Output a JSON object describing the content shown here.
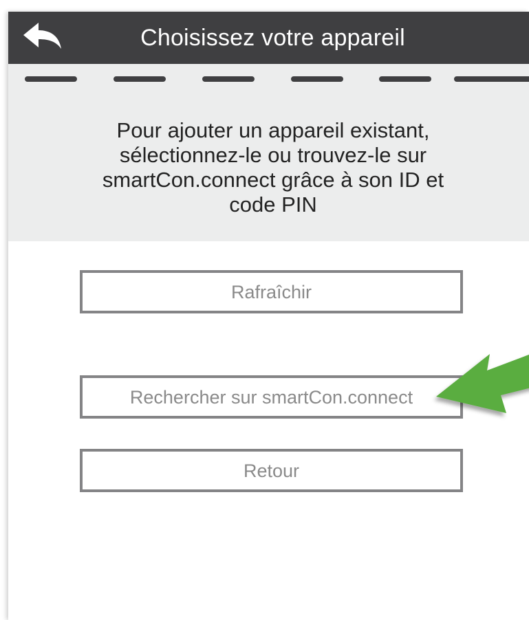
{
  "header": {
    "title": "Choisissez votre appareil",
    "back_icon": "back-arrow-icon"
  },
  "progress": {
    "segments": 6
  },
  "info": {
    "lines": [
      "Pour ajouter un appareil existant,",
      "sélectionnez-le ou trouvez-le sur",
      "smartCon.connect grâce à son ID et",
      "code PIN"
    ]
  },
  "buttons": {
    "refresh": "Rafraîchir",
    "search": "Rechercher sur smartCon.connect",
    "back": "Retour"
  },
  "annotation": {
    "pointer_icon": "green-pointer-arrow-icon",
    "color": "#5aad3f"
  },
  "colors": {
    "header_bg": "#3f3f41",
    "info_bg": "#eceded",
    "button_border": "#848486",
    "button_text": "#8a8a8a"
  }
}
